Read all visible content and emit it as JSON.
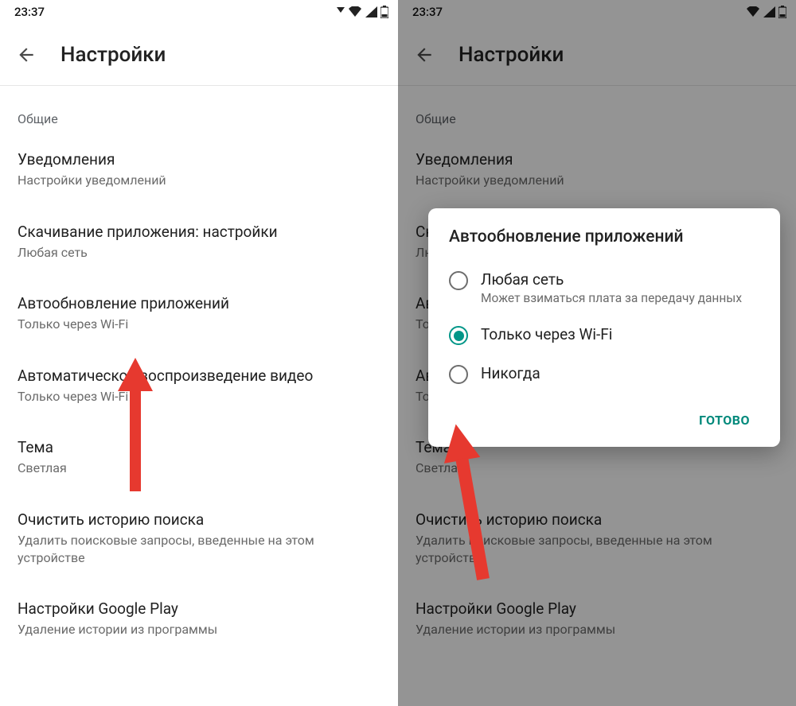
{
  "status": {
    "time": "23:37"
  },
  "app_bar": {
    "title": "Настройки"
  },
  "section": {
    "label": "Общие"
  },
  "settings": {
    "notifications": {
      "title": "Уведомления",
      "subtitle": "Настройки уведомлений"
    },
    "download": {
      "title": "Скачивание приложения: настройки",
      "subtitle": "Любая сеть"
    },
    "autoupdate": {
      "title": "Автообновление приложений",
      "subtitle": "Только через Wi-Fi"
    },
    "autoplay": {
      "title": "Автоматическое воспроизведение видео",
      "subtitle": "Только через Wi-Fi"
    },
    "theme": {
      "title": "Тема",
      "subtitle": "Светлая"
    },
    "clear_history": {
      "title": "Очистить историю поиска",
      "subtitle": "Удалить поисковые запросы, введенные на этом устройстве"
    },
    "gplay": {
      "title": "Настройки Google Play",
      "subtitle": "Удаление истории из программы"
    }
  },
  "dialog": {
    "title": "Автообновление приложений",
    "options": [
      {
        "label": "Любая сеть",
        "sub": "Может взиматься плата за передачу данных",
        "selected": false
      },
      {
        "label": "Только через Wi-Fi",
        "sub": "",
        "selected": true
      },
      {
        "label": "Никогда",
        "sub": "",
        "selected": false
      }
    ],
    "done": "ГОТОВО"
  }
}
